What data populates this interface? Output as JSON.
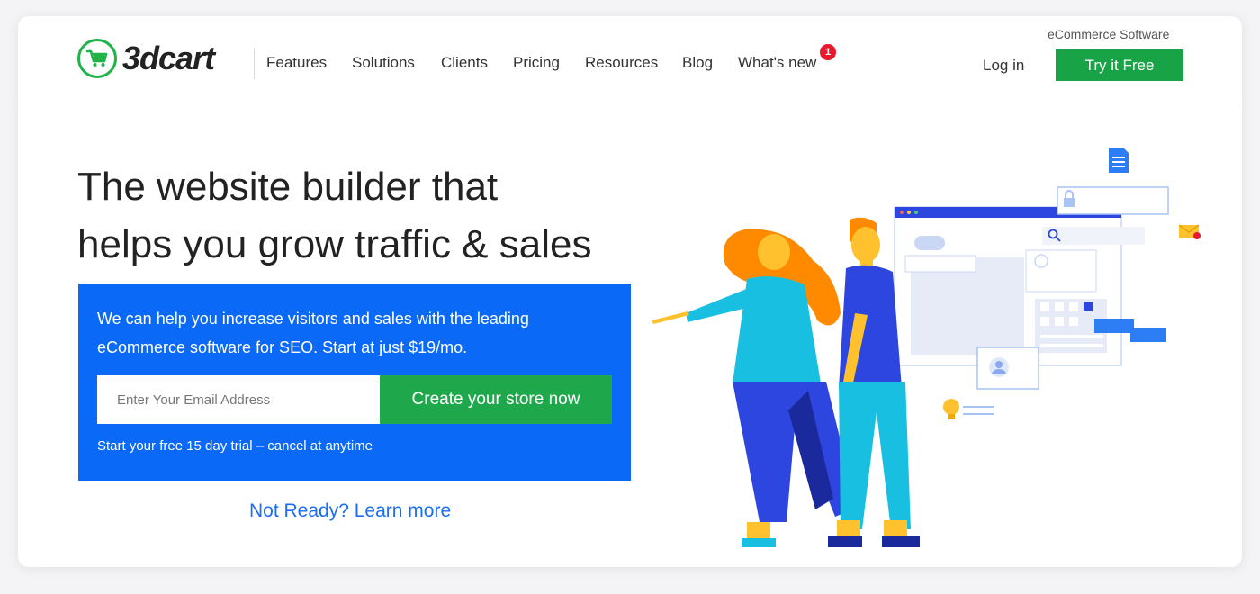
{
  "header": {
    "logo_text": "3dcart",
    "tagline": "eCommerce Software",
    "nav": [
      {
        "label": "Features"
      },
      {
        "label": "Solutions"
      },
      {
        "label": "Clients"
      },
      {
        "label": "Pricing"
      },
      {
        "label": "Resources"
      },
      {
        "label": "Blog"
      },
      {
        "label": "What's new"
      }
    ],
    "whats_new_badge": "1",
    "login_label": "Log in",
    "try_label": "Try it Free"
  },
  "hero": {
    "title_line1": "The website builder that",
    "title_line2": "helps you grow traffic & sales",
    "description_line1": "We can help you increase visitors and sales with the leading",
    "description_line2": "eCommerce software for SEO. Start at just $19/mo.",
    "email_placeholder": "Enter Your Email Address",
    "cta_label": "Create your store now",
    "trial_text": "Start your free 15 day trial – cancel at anytime",
    "learn_more": "Not Ready? Learn more"
  },
  "colors": {
    "brand_green": "#1fa84b",
    "hero_blue": "#0a6af7",
    "link_blue": "#1c6df2",
    "badge_red": "#e8192c"
  },
  "icons": [
    "cart-icon",
    "lock-icon",
    "document-icon",
    "mail-icon",
    "search-icon",
    "lightbulb-icon",
    "user-icon"
  ]
}
